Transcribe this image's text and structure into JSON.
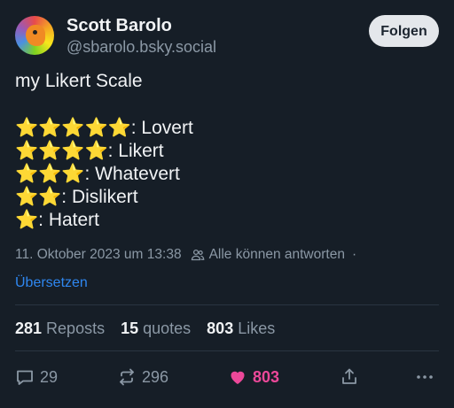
{
  "author": {
    "display_name": "Scott Barolo",
    "handle": "@sbarolo.bsky.social"
  },
  "follow_button": "Folgen",
  "post": {
    "title": "my Likert Scale",
    "scale": [
      {
        "stars": 5,
        "stars_text": "⭐⭐⭐⭐⭐",
        "label": ":  Lovert"
      },
      {
        "stars": 4,
        "stars_text": "⭐⭐⭐⭐",
        "label": ":  Likert"
      },
      {
        "stars": 3,
        "stars_text": "⭐⭐⭐",
        "label": ":  Whatevert"
      },
      {
        "stars": 2,
        "stars_text": "⭐⭐",
        "label": ":  Dislikert"
      },
      {
        "stars": 1,
        "stars_text": "⭐",
        "label": ":  Hatert"
      }
    ]
  },
  "meta": {
    "timestamp": "11. Oktober 2023 um 13:38",
    "reply_setting": "Alle können antworten",
    "separator": "·"
  },
  "translate_link": "Übersetzen",
  "stats": {
    "reposts_count": "281",
    "reposts_label": "Reposts",
    "quotes_count": "15",
    "quotes_label": "quotes",
    "likes_count": "803",
    "likes_label": "Likes"
  },
  "actions": {
    "reply_count": "29",
    "repost_count": "296",
    "like_count": "803"
  },
  "colors": {
    "background": "#161e27",
    "accent_link": "#2f87f0",
    "like": "#ec4899"
  }
}
